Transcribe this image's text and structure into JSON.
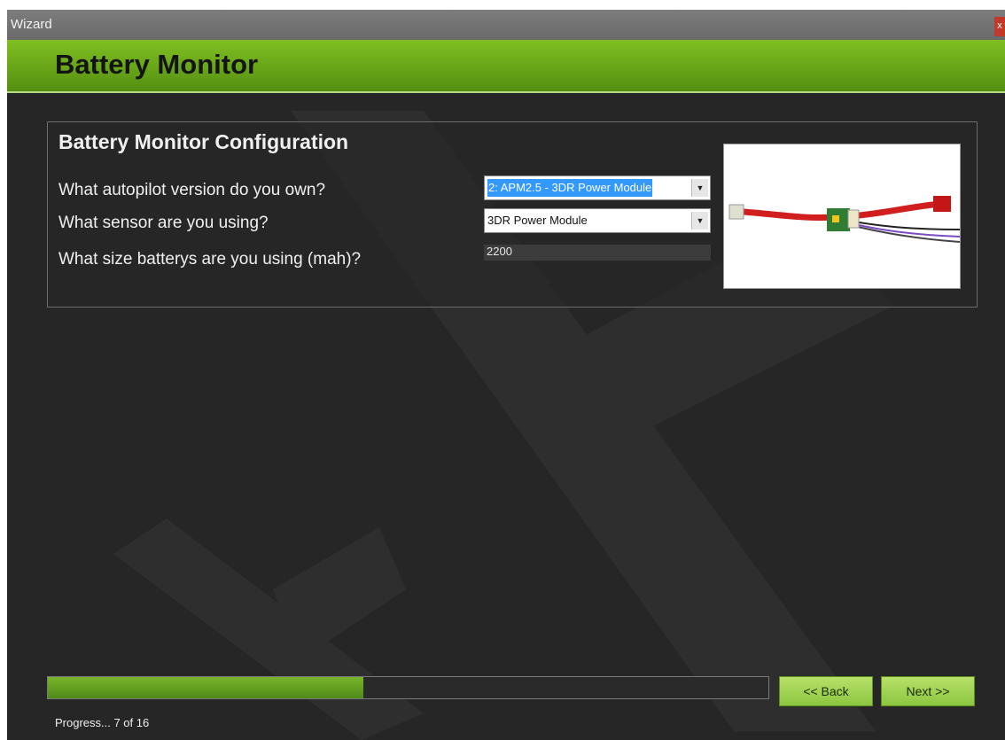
{
  "window": {
    "title": "Wizard",
    "close_label": "x"
  },
  "header": {
    "title": "Battery Monitor"
  },
  "panel": {
    "heading": "Battery Monitor Configuration",
    "questions": [
      "What autopilot version do you own?",
      "What sensor are you using?",
      "What size batterys are you using (mah)?"
    ],
    "autopilot_select": {
      "value": "2: APM2.5 - 3DR Power Module"
    },
    "sensor_select": {
      "value": "3DR Power Module"
    },
    "battery_capacity": {
      "value": "2200"
    },
    "image_icon": "power-module-photo"
  },
  "footer": {
    "progress_text": "Progress... 7 of 16",
    "progress_fraction": 0.4375,
    "back_label": "<< Back",
    "next_label": "Next >>"
  },
  "colors": {
    "header_green": "#6aa81c",
    "background": "#262626",
    "button_green": "#a6d45a",
    "selection_blue": "#3399ff"
  }
}
